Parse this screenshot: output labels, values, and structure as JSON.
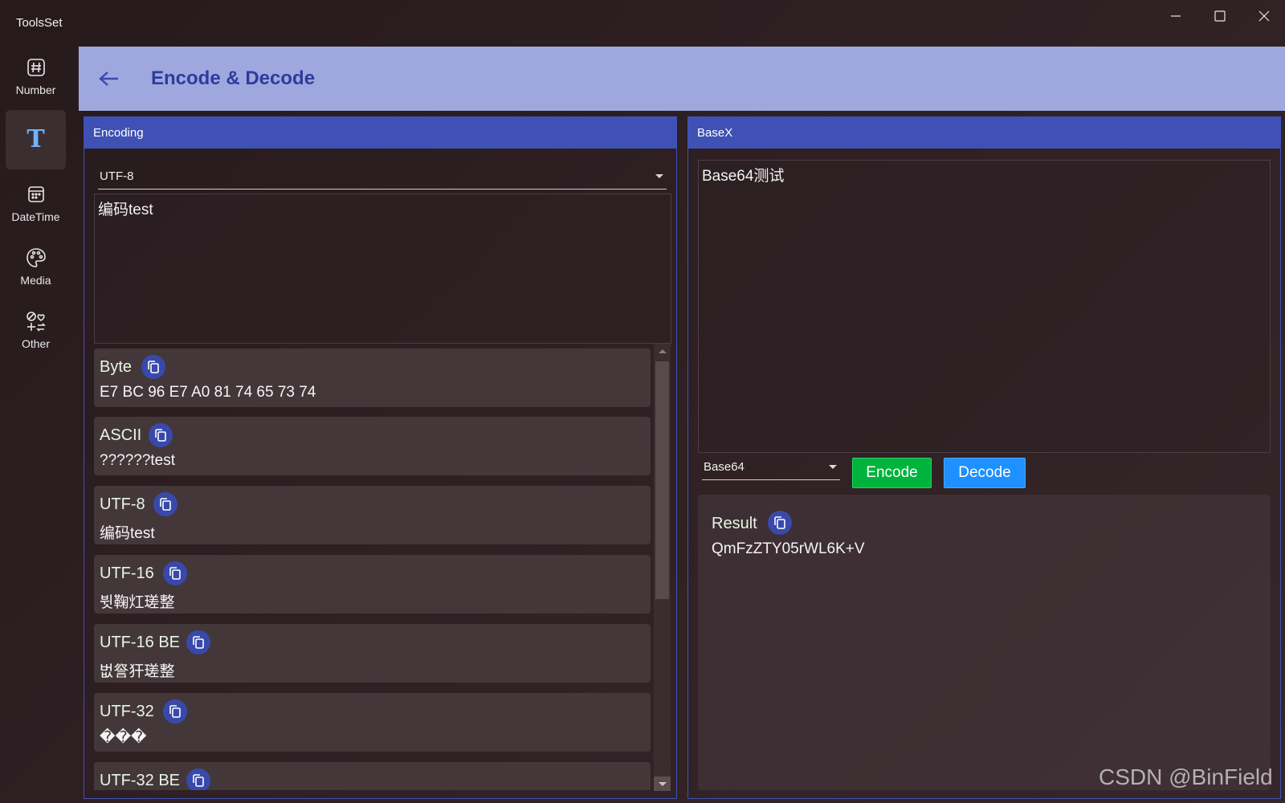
{
  "window": {
    "title": "ToolsSet",
    "minimize_icon": "minimize-icon",
    "maximize_icon": "maximize-icon",
    "close_icon": "close-icon"
  },
  "sidebar": {
    "items": [
      {
        "label": "Number",
        "icon": "hash-icon",
        "selected": false
      },
      {
        "label": "T",
        "icon": "text-icon",
        "selected": true,
        "glyph": "T"
      },
      {
        "label": "DateTime",
        "icon": "calendar-icon",
        "selected": false
      },
      {
        "label": "Media",
        "icon": "palette-icon",
        "selected": false
      },
      {
        "label": "Other",
        "icon": "shapes-icon",
        "selected": false
      }
    ],
    "accent": "#6fb3ff"
  },
  "header": {
    "title": "Encode & Decode",
    "back_icon": "back-arrow-icon",
    "background": "#9fa8de",
    "title_color": "#2e3b9e"
  },
  "encoding_panel": {
    "header": "Encoding",
    "encoding_select": "UTF-8",
    "input_text": "编码test",
    "results": [
      {
        "label": "Byte",
        "value": "E7 BC 96 E7 A0 81 74 65 73 74"
      },
      {
        "label": "ASCII",
        "value": "??????test"
      },
      {
        "label": "UTF-8",
        "value": "编码test"
      },
      {
        "label": "UTF-16",
        "value": "뷧鞠灴瑳整"
      },
      {
        "label": "UTF-16 BE",
        "value": "벖詧犴瑳整"
      },
      {
        "label": "UTF-32",
        "value": "���"
      },
      {
        "label": "UTF-32 BE",
        "value": ""
      }
    ]
  },
  "basex_panel": {
    "header": "BaseX",
    "input_text": "Base64测试",
    "base_select": "Base64",
    "encode_label": "Encode",
    "decode_label": "Decode",
    "result_label": "Result",
    "result_value": "QmFzZTY05rWL6K+V"
  },
  "colors": {
    "panel_header": "#3f51b5",
    "copy_button": "#3949ab",
    "encode_button": "#00b33c",
    "decode_button": "#1e90ff"
  },
  "watermark": "CSDN @BinField"
}
